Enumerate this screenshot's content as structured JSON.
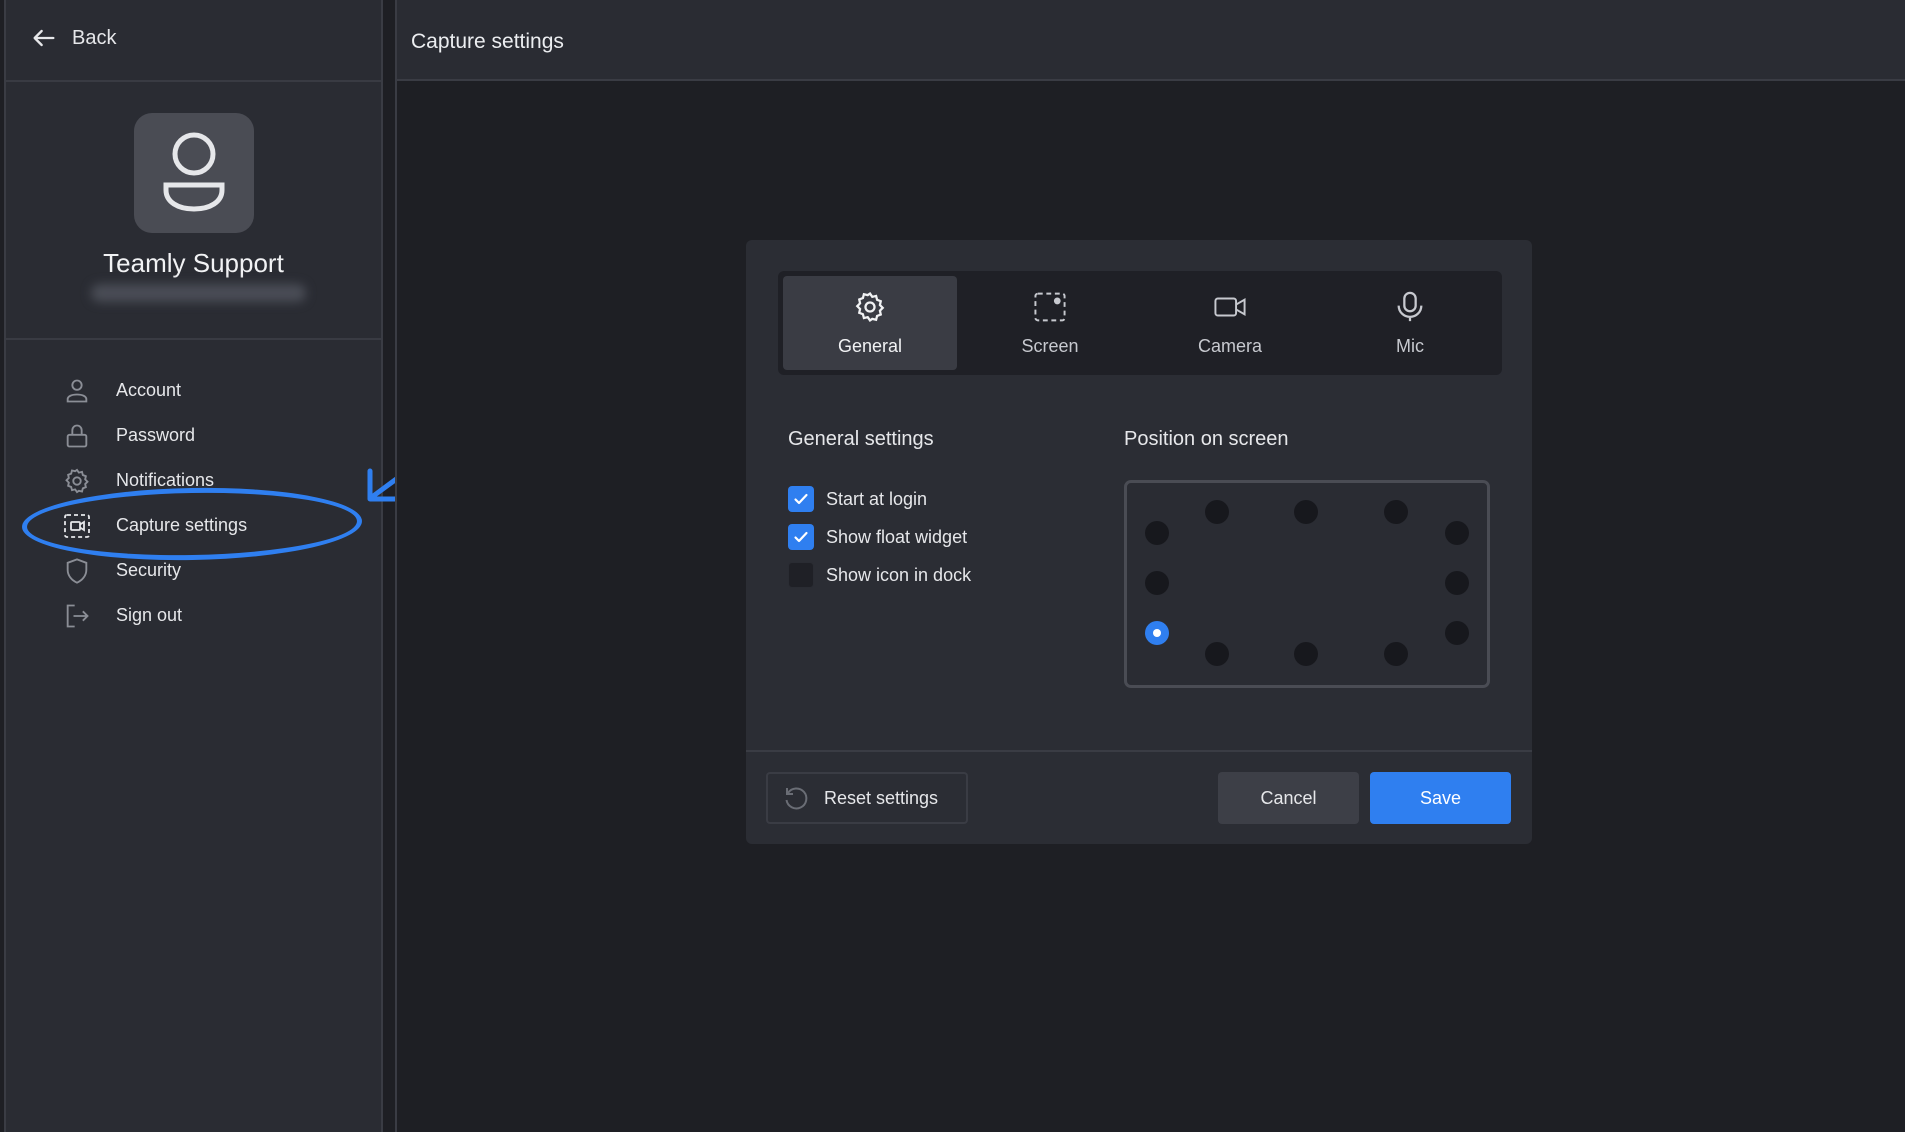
{
  "nav": {
    "back_label": "Back"
  },
  "profile": {
    "name": "Teamly Support"
  },
  "sidebar": {
    "items": [
      {
        "label": "Account",
        "icon": "user-icon"
      },
      {
        "label": "Password",
        "icon": "lock-icon"
      },
      {
        "label": "Notifications",
        "icon": "gear-icon"
      },
      {
        "label": "Capture settings",
        "icon": "capture-icon"
      },
      {
        "label": "Security",
        "icon": "shield-icon"
      },
      {
        "label": "Sign out",
        "icon": "sign-out-icon"
      }
    ],
    "highlighted": "Capture settings"
  },
  "header": {
    "title": "Capture settings"
  },
  "dialog": {
    "tabs": [
      {
        "label": "General",
        "icon": "gear-icon",
        "active": true
      },
      {
        "label": "Screen",
        "icon": "screen-select-icon",
        "active": false
      },
      {
        "label": "Camera",
        "icon": "camera-icon",
        "active": false
      },
      {
        "label": "Mic",
        "icon": "mic-icon",
        "active": false
      }
    ],
    "general_title": "General settings",
    "position_title": "Position on screen",
    "options": [
      {
        "label": "Start at login",
        "checked": true
      },
      {
        "label": "Show float widget",
        "checked": true
      },
      {
        "label": "Show icon in dock",
        "checked": false
      }
    ],
    "position_selected": "bottom-left",
    "buttons": {
      "reset": "Reset settings",
      "cancel": "Cancel",
      "save": "Save"
    }
  },
  "colors": {
    "accent": "#2f7ff0",
    "background": "#1e1f24",
    "panel": "#2b2d34"
  }
}
